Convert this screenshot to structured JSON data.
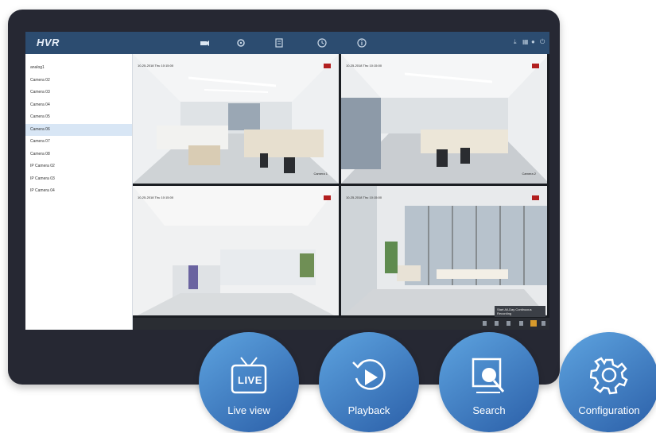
{
  "app": {
    "logo": "HVR"
  },
  "topbar": {
    "nav_icons": [
      "camera-icon",
      "settings-icon",
      "notes-icon",
      "clock-icon",
      "info-icon"
    ],
    "right_icons": [
      "download-icon",
      "grid-icon",
      "lock-icon",
      "power-icon"
    ]
  },
  "sidebar": {
    "items": [
      {
        "label": "analog1"
      },
      {
        "label": "Camera 02"
      },
      {
        "label": "Camera 03"
      },
      {
        "label": "Camera 04"
      },
      {
        "label": "Camera 05"
      },
      {
        "label": "Camera 06",
        "selected": true
      },
      {
        "label": "Camera 07"
      },
      {
        "label": "Camera 08"
      },
      {
        "label": "IP Camera 02"
      },
      {
        "label": "IP Camera 03"
      },
      {
        "label": "IP Camera 04"
      }
    ]
  },
  "grid": {
    "tiles": [
      {
        "stamp": "10-25-2018 Thu 10:15:00",
        "label": "Camera 1"
      },
      {
        "stamp": "10-25-2018 Thu 10:15:00",
        "label": "Camera 2"
      },
      {
        "stamp": "10-25-2018 Thu 10:15:00",
        "label": ""
      },
      {
        "stamp": "10-25-2018 Thu 10:15:00",
        "label": ""
      }
    ],
    "tooltip": "Start All-Day Continuous Recording"
  },
  "features": [
    {
      "label": "Live view",
      "icon": "tv-live-icon",
      "badge": "LIVE"
    },
    {
      "label": "Playback",
      "icon": "playback-icon"
    },
    {
      "label": "Search",
      "icon": "search-icon"
    },
    {
      "label": "Configuration",
      "icon": "gear-icon"
    }
  ],
  "colors": {
    "frame": "#262833",
    "topbar": "#2c4c70",
    "feature_gradient_start": "#5ea4e0",
    "feature_gradient_end": "#2b5fa8",
    "rec_badge": "#b21f1f"
  }
}
